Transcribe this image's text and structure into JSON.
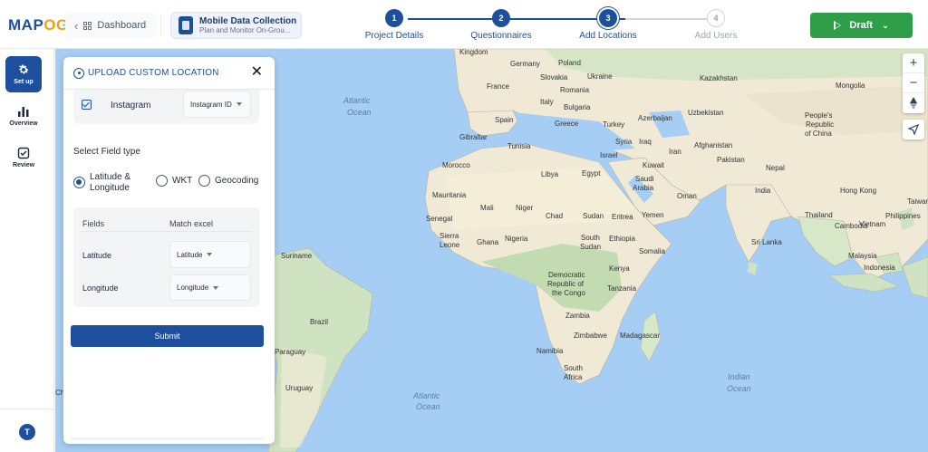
{
  "brand": {
    "logo_main": "MAP",
    "logo_accent": "OG"
  },
  "header": {
    "back_label": "Dashboard",
    "project": {
      "name": "Mobile Data Collection",
      "subtitle": "Plan and Monitor On-Grou..."
    },
    "steps": [
      {
        "number": "1",
        "label": "Project Details",
        "state": "done"
      },
      {
        "number": "2",
        "label": "Questionnaires",
        "state": "done"
      },
      {
        "number": "3",
        "label": "Add Locations",
        "state": "current"
      },
      {
        "number": "4",
        "label": "Add Users",
        "state": "todo"
      }
    ],
    "draft_label": "Draft"
  },
  "sidebar": {
    "items": [
      {
        "label": "Set up",
        "icon": "gear-icon",
        "active": true
      },
      {
        "label": "Overview",
        "icon": "bar-chart-icon",
        "active": false
      },
      {
        "label": "Review",
        "icon": "checkbox-icon",
        "active": false
      }
    ],
    "avatar_initial": "T"
  },
  "panel": {
    "title": "UPLOAD CUSTOM LOCATION",
    "instagram": {
      "label": "Instagram",
      "checked": true,
      "select_value": "Instagram ID"
    },
    "field_type_label": "Select Field type",
    "field_types": [
      {
        "label_line1": "Latitude &",
        "label_line2": "Longitude",
        "selected": true
      },
      {
        "label": "WKT",
        "selected": false
      },
      {
        "label": "Geocoding",
        "selected": false
      }
    ],
    "match": {
      "col_fields": "Fields",
      "col_match": "Match excel",
      "rows": [
        {
          "field": "Latitude",
          "value": "Latitude"
        },
        {
          "field": "Longitude",
          "value": "Longitude"
        }
      ]
    },
    "submit_label": "Submit"
  },
  "map": {
    "controls": {
      "zoom_in": "+",
      "zoom_out": "−"
    },
    "labels": [
      "Kingdom",
      "Germany",
      "Poland",
      "Ukraine",
      "Kazakhstan",
      "Mongolia",
      "France",
      "Slovakia",
      "Romania",
      "Italy",
      "Bulgaria",
      "Uzbekistan",
      "Spain",
      "Greece",
      "Turkey",
      "Azerbaijan",
      "People's",
      "Republic",
      "of China",
      "Gibraltar",
      "Tunisia",
      "Syria",
      "Iraq",
      "Iran",
      "Afghanistan",
      "Morocco",
      "Israel",
      "Kuwait",
      "Pakistan",
      "Libya",
      "Egypt",
      "Saudi",
      "Arabia",
      "Nepal",
      "Mauritania",
      "Oman",
      "India",
      "Hong Kong",
      "Mali",
      "Niger",
      "Taiwan",
      "Senegal",
      "Chad",
      "Sudan",
      "Eritrea",
      "Yemen",
      "Vietnam",
      "Philippines",
      "Sierra",
      "Leone",
      "Ghana",
      "Nigeria",
      "South",
      "Sudan",
      "Ethiopia",
      "Somalia",
      "Thailand",
      "Cambodia",
      "Sri Lanka",
      "Malaysia",
      "Indonesia",
      "Democratic",
      "Republic of",
      "the Congo",
      "Kenya",
      "Tanzania",
      "Suriname",
      "Brazil",
      "Zambia",
      "Madagascar",
      "Zimbabwe",
      "Namibia",
      "South",
      "Africa",
      "Paraguay",
      "Uruguay",
      "Chile",
      "Atlantic",
      "Ocean",
      "Atlantic",
      "Ocean",
      "Indian",
      "Ocean"
    ]
  }
}
